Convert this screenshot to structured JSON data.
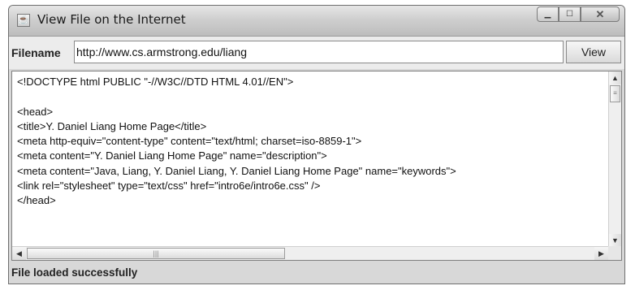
{
  "window": {
    "title": "View File on the Internet",
    "icon": "java-app-icon"
  },
  "toolbar": {
    "filename_label": "Filename",
    "url_value": "http://www.cs.armstrong.edu/liang",
    "view_label": "View"
  },
  "content": {
    "text": "<!DOCTYPE html PUBLIC \"-//W3C//DTD HTML 4.01//EN\">\n\n<head>\n<title>Y. Daniel Liang Home Page</title>\n<meta http-equiv=\"content-type\" content=\"text/html; charset=iso-8859-1\">\n<meta content=\"Y. Daniel Liang Home Page\" name=\"description\">\n<meta content=\"Java, Liang, Y. Daniel Liang, Y. Daniel Liang Home Page\" name=\"keywords\">\n<link rel=\"stylesheet\" type=\"text/css\" href=\"intro6e/intro6e.css\" />\n</head>"
  },
  "status": {
    "message": "File loaded successfully"
  },
  "colors": {
    "titlebar": "#cfcfcf",
    "background": "#ececec"
  }
}
